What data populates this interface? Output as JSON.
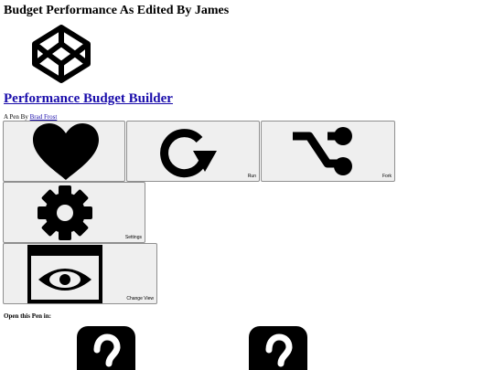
{
  "page": {
    "title": "Budget Performance As Edited By James"
  },
  "pen": {
    "title": "Performance Budget Builder",
    "byline_prefix": "A Pen By",
    "author": "Brad Frost"
  },
  "actions": [
    {
      "id": "love",
      "label": "",
      "icon": "heart-icon"
    },
    {
      "id": "run",
      "label": "Run",
      "icon": "refresh-icon"
    },
    {
      "id": "fork",
      "label": "Fork",
      "icon": "fork-icon"
    },
    {
      "id": "settings",
      "label": "Settings",
      "icon": "gear-icon"
    },
    {
      "id": "change_view",
      "label": "Change View",
      "icon": "eye-window-icon"
    }
  ],
  "open_in": {
    "heading": "Open this Pen in:",
    "options": [
      {
        "icon": "question-mark-icon"
      },
      {
        "icon": "question-mark-icon"
      }
    ]
  }
}
